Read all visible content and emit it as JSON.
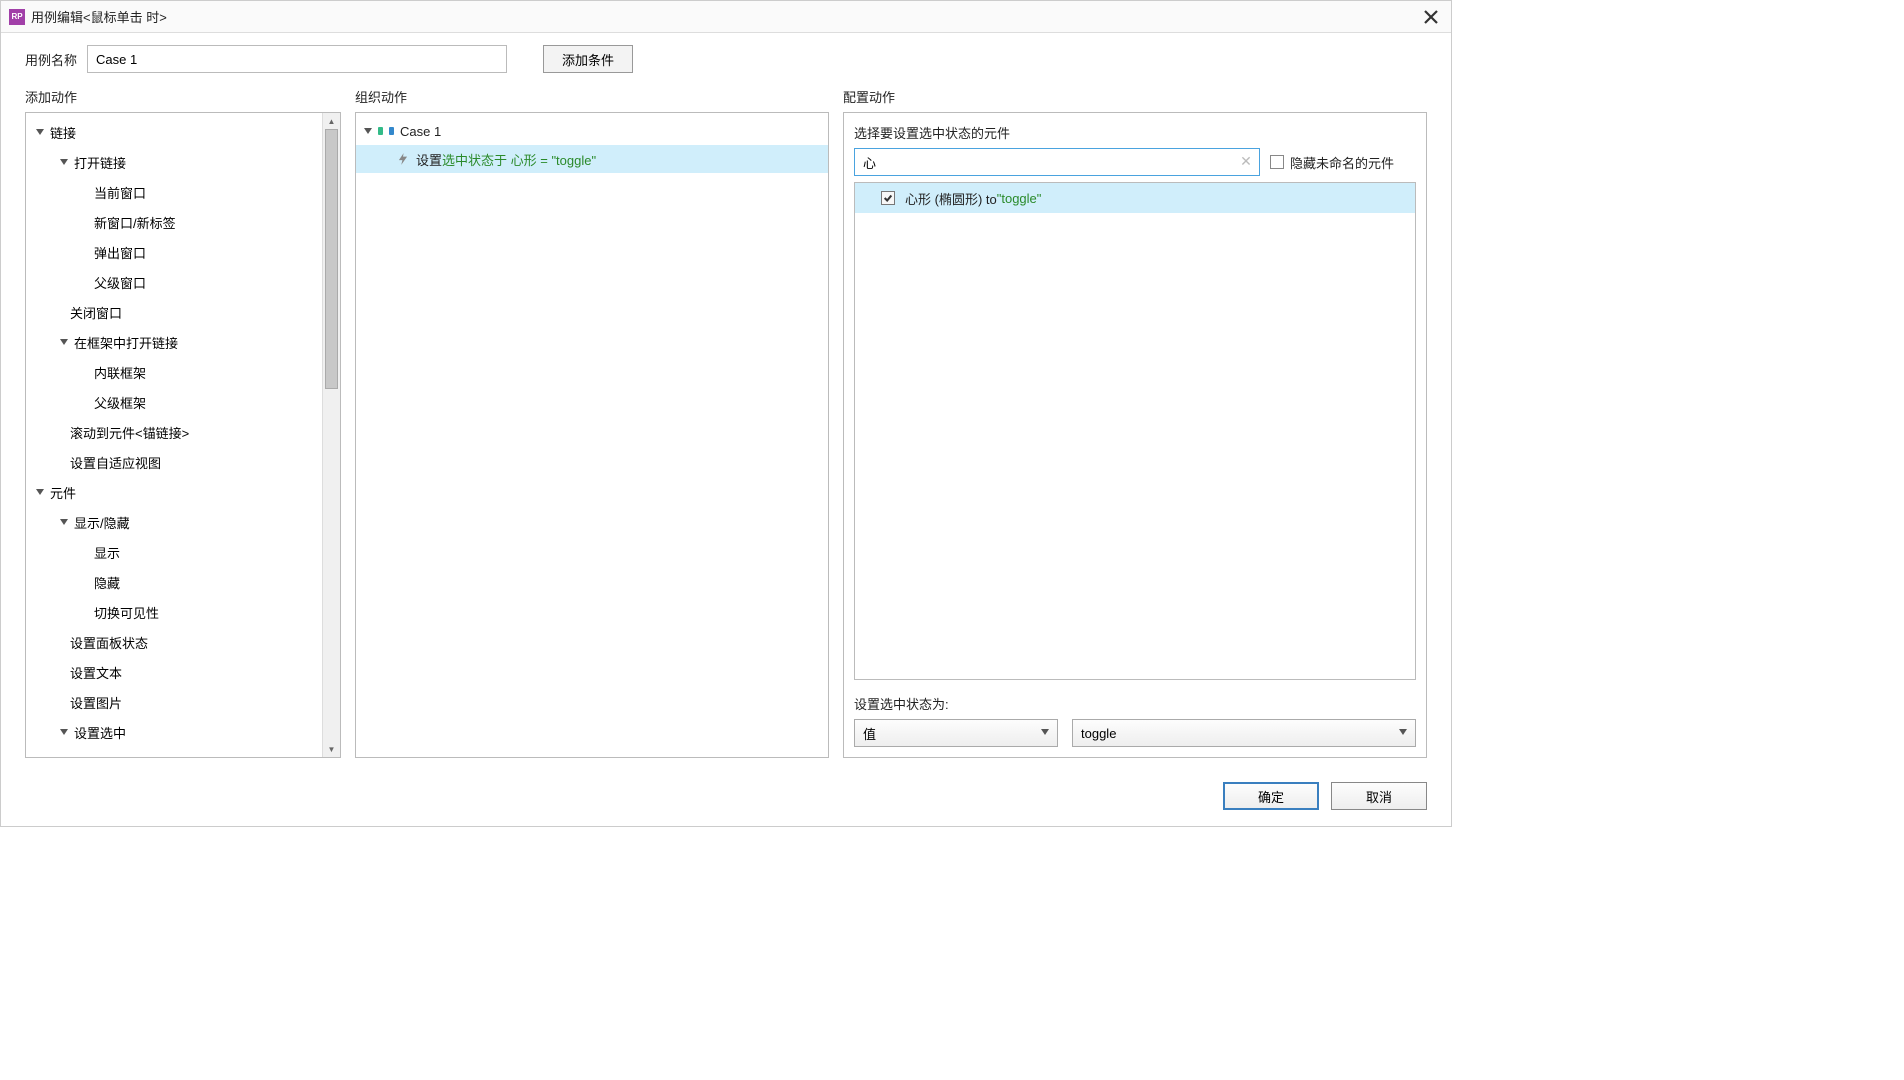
{
  "title": "用例编辑<鼠标单击 时>",
  "app_icon": "RP",
  "case_name_label": "用例名称",
  "case_name_value": "Case 1",
  "add_condition": "添加条件",
  "columns": {
    "left": "添加动作",
    "mid": "组织动作",
    "right": "配置动作"
  },
  "left_tree": {
    "links": "链接",
    "open_link": "打开链接",
    "current_window": "当前窗口",
    "new_window_tab": "新窗口/新标签",
    "popup_window": "弹出窗口",
    "parent_window": "父级窗口",
    "close_window": "关闭窗口",
    "open_in_frame": "在框架中打开链接",
    "inline_frame": "内联框架",
    "parent_frame": "父级框架",
    "scroll_to_anchor": "滚动到元件<锚链接>",
    "set_adaptive_view": "设置自适应视图",
    "widgets": "元件",
    "show_hide": "显示/隐藏",
    "show": "显示",
    "hide": "隐藏",
    "toggle_vis": "切换可见性",
    "set_panel_state": "设置面板状态",
    "set_text": "设置文本",
    "set_image": "设置图片",
    "set_selected": "设置选中"
  },
  "mid": {
    "case": "Case 1",
    "action_prefix": "设置 ",
    "action_green1": "选中状态于 心形 = \"toggle\""
  },
  "right": {
    "select_prompt": "选择要设置选中状态的元件",
    "filter_value": "心",
    "hide_unnamed": "隐藏未命名的元件",
    "row_name": "心形 (椭圆形) to ",
    "row_value": "\"toggle\"",
    "set_state_label": "设置选中状态为:",
    "combo1": "值",
    "combo2": "toggle"
  },
  "buttons": {
    "ok": "确定",
    "cancel": "取消"
  }
}
